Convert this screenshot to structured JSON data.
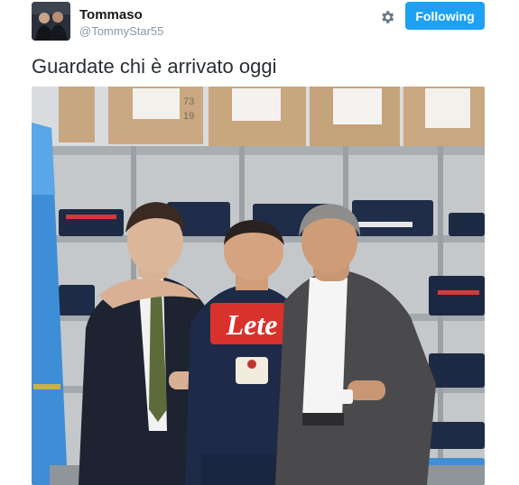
{
  "user": {
    "name": "Tommaso",
    "handle": "@TommyStar55"
  },
  "actions": {
    "follow_label": "Following",
    "settings_icon": "gear-icon"
  },
  "tweet": {
    "text": "Guardate chi è arrivato oggi"
  },
  "photo": {
    "shirt_sponsor": "Lete",
    "box_marks": [
      "73",
      "19"
    ]
  },
  "colors": {
    "accent": "#1da1f2",
    "handle": "#8899a6",
    "text": "#292f33"
  }
}
